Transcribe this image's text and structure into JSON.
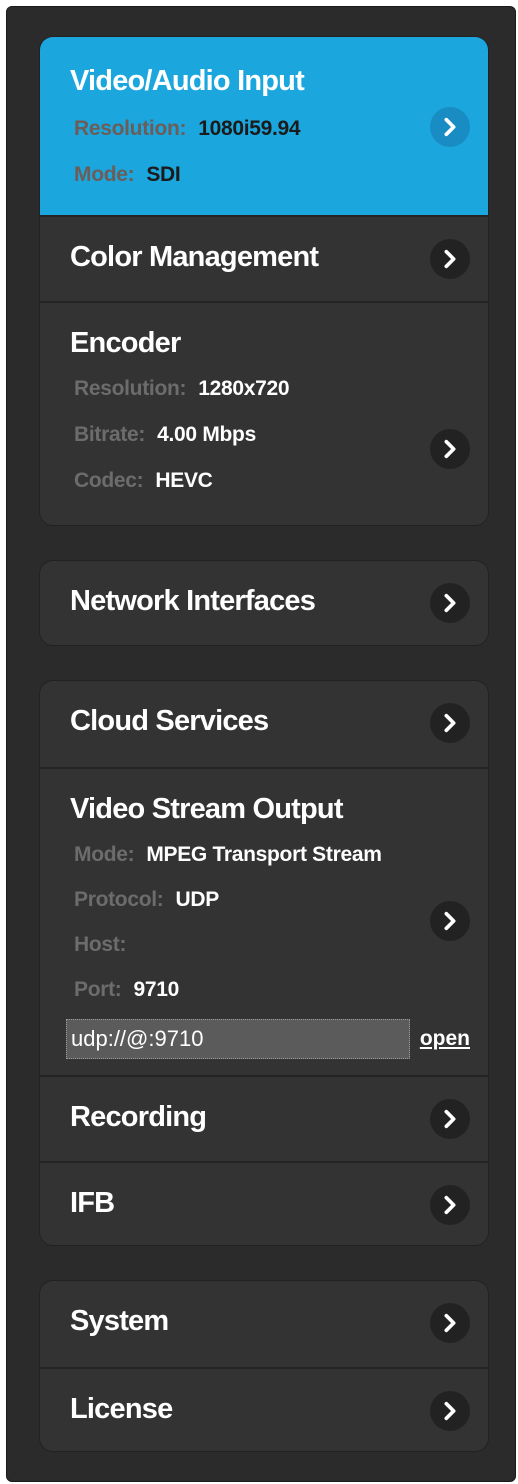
{
  "groups": {
    "input_section": {
      "video_audio_input": {
        "title": "Video/Audio Input",
        "resolution_label": "Resolution:",
        "resolution_value": "1080i59.94",
        "mode_label": "Mode:",
        "mode_value": "SDI"
      },
      "color_management": {
        "title": "Color Management"
      },
      "encoder": {
        "title": "Encoder",
        "resolution_label": "Resolution:",
        "resolution_value": "1280x720",
        "bitrate_label": "Bitrate:",
        "bitrate_value": "4.00 Mbps",
        "codec_label": "Codec:",
        "codec_value": "HEVC"
      }
    },
    "network_section": {
      "network_interfaces": {
        "title": "Network Interfaces"
      }
    },
    "output_section": {
      "cloud_services": {
        "title": "Cloud Services"
      },
      "video_stream_output": {
        "title": "Video Stream Output",
        "mode_label": "Mode:",
        "mode_value": "MPEG Transport Stream",
        "protocol_label": "Protocol:",
        "protocol_value": "UDP",
        "host_label": "Host:",
        "host_value": "",
        "port_label": "Port:",
        "port_value": "9710",
        "url_value": "udp://@:9710",
        "open_label": "open"
      },
      "recording": {
        "title": "Recording"
      },
      "ifb": {
        "title": "IFB"
      }
    },
    "system_section": {
      "system": {
        "title": "System"
      },
      "license": {
        "title": "License"
      }
    }
  },
  "colors": {
    "accent": "#1ba6dd",
    "panel": "#2b2b2b",
    "card": "#333333"
  },
  "icons": {
    "chevron": "chevron-right-icon"
  }
}
